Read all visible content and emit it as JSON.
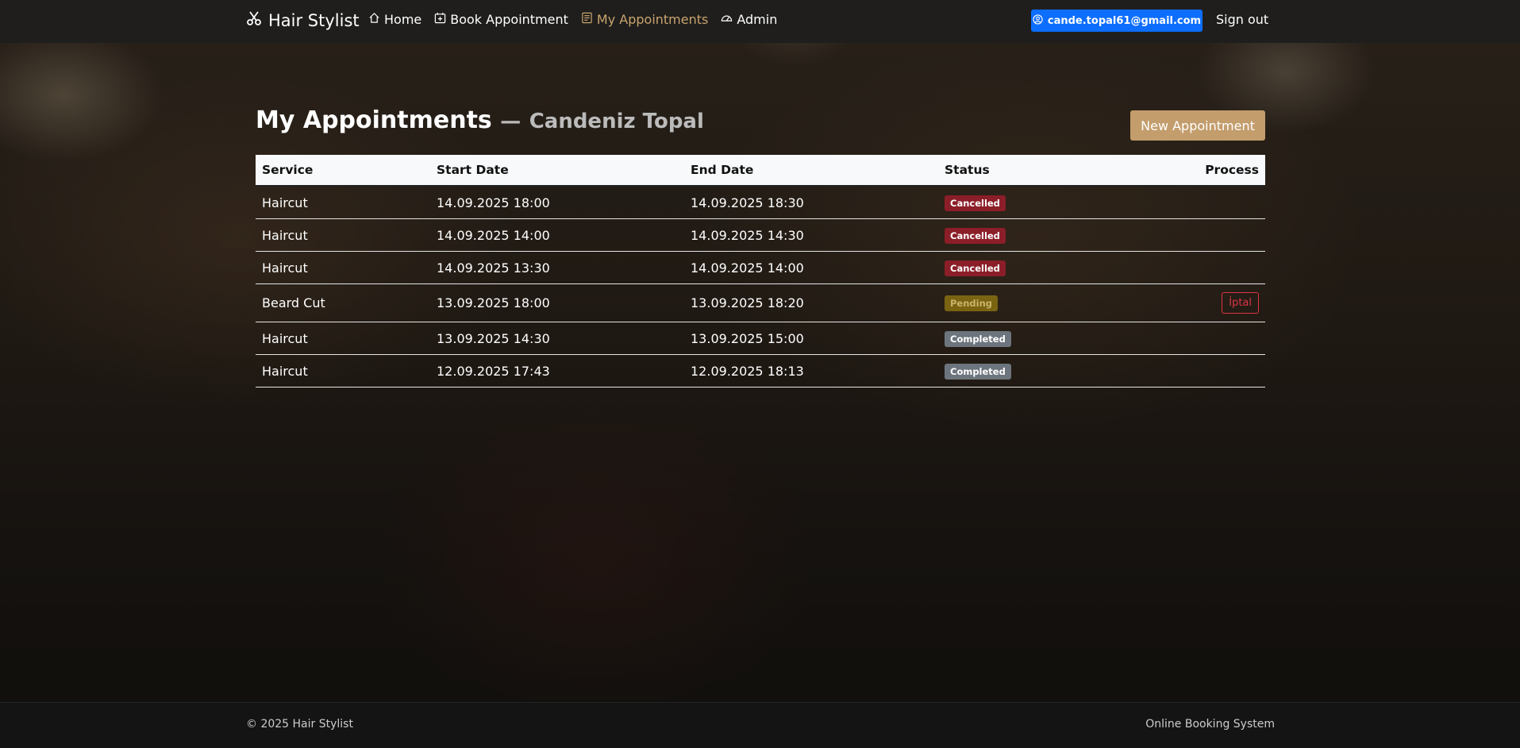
{
  "nav": {
    "brand": "Hair Stylist",
    "links": [
      {
        "label": "Home",
        "icon": "home-icon"
      },
      {
        "label": "Book Appointment",
        "icon": "calendar-plus-icon"
      },
      {
        "label": "My Appointments",
        "icon": "list-icon",
        "active": true
      },
      {
        "label": "Admin",
        "icon": "dashboard-icon"
      }
    ],
    "user_email": "cande.topal61@gmail.com",
    "signout": "Sign out"
  },
  "page": {
    "title": "My Appointments",
    "separator": "—",
    "user_name": "Candeniz Topal",
    "new_button": "New Appointment"
  },
  "table": {
    "headers": [
      "Service",
      "Start Date",
      "End Date",
      "Status",
      "Process"
    ],
    "rows": [
      {
        "service": "Haircut",
        "start": "14.09.2025 18:00",
        "end": "14.09.2025 18:30",
        "status": "Cancelled",
        "action": ""
      },
      {
        "service": "Haircut",
        "start": "14.09.2025 14:00",
        "end": "14.09.2025 14:30",
        "status": "Cancelled",
        "action": ""
      },
      {
        "service": "Haircut",
        "start": "14.09.2025 13:30",
        "end": "14.09.2025 14:00",
        "status": "Cancelled",
        "action": ""
      },
      {
        "service": "Beard Cut",
        "start": "13.09.2025 18:00",
        "end": "13.09.2025 18:20",
        "status": "Pending",
        "action": "İptal"
      },
      {
        "service": "Haircut",
        "start": "13.09.2025 14:30",
        "end": "13.09.2025 15:00",
        "status": "Completed",
        "action": ""
      },
      {
        "service": "Haircut",
        "start": "12.09.2025 17:43",
        "end": "12.09.2025 18:13",
        "status": "Completed",
        "action": ""
      }
    ]
  },
  "footer": {
    "copyright": "© 2025 Hair Stylist",
    "tagline": "Online Booking System"
  },
  "colors": {
    "accent": "#c39d6c",
    "primary": "#0d6efd",
    "cancelled": "#8b1e28",
    "pending": "#7a6412",
    "completed": "#6c757d",
    "danger": "#dc3545"
  }
}
